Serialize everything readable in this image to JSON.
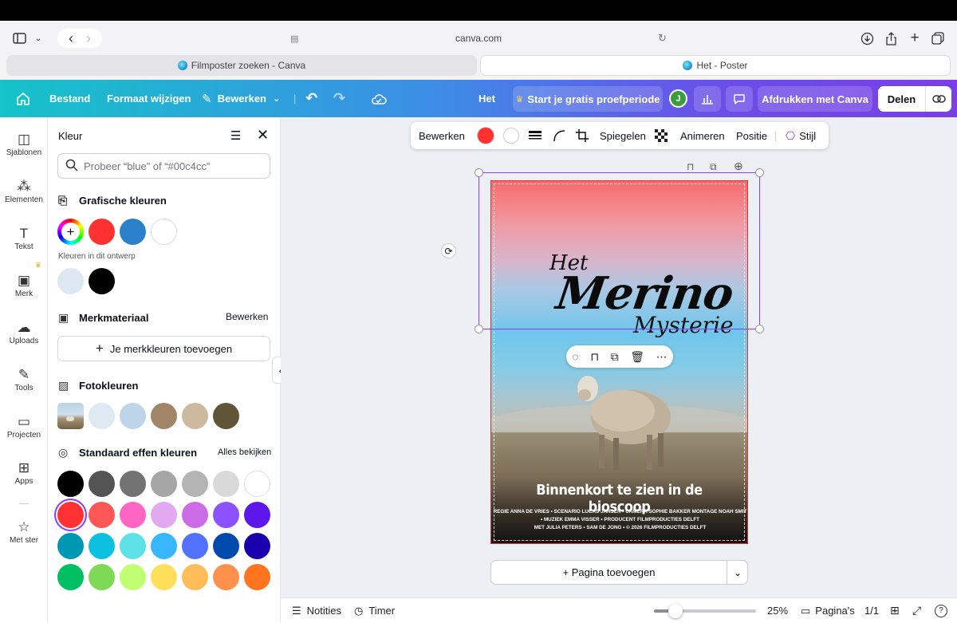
{
  "browser": {
    "url": "canva.com",
    "tabs": [
      {
        "label": "Filmposter zoeken - Canva",
        "active": false
      },
      {
        "label": "Het - Poster",
        "active": true
      }
    ]
  },
  "header": {
    "home_icon": "home-icon",
    "file": "Bestand",
    "resize": "Formaat wijzigen",
    "edit": "Bewerken",
    "doc_title": "Het",
    "trial": "Start je gratis proefperiode",
    "avatar": "J",
    "print": "Afdrukken met Canva",
    "share": "Delen"
  },
  "rail": [
    {
      "label": "Sjablonen",
      "icon": "templates-icon",
      "glyph": "◫"
    },
    {
      "label": "Elementen",
      "icon": "elements-icon",
      "glyph": "⁂"
    },
    {
      "label": "Tekst",
      "icon": "text-icon",
      "glyph": "T"
    },
    {
      "label": "Merk",
      "icon": "brand-icon",
      "glyph": "▣"
    },
    {
      "label": "Uploads",
      "icon": "upload-icon",
      "glyph": "☁"
    },
    {
      "label": "Tools",
      "icon": "tools-icon",
      "glyph": "✎"
    },
    {
      "label": "Projecten",
      "icon": "folder-icon",
      "glyph": "▭"
    },
    {
      "label": "Apps",
      "icon": "apps-icon",
      "glyph": "⊞"
    },
    {
      "label": "Met ster",
      "icon": "star-icon",
      "glyph": "☆"
    }
  ],
  "panel": {
    "title": "Kleur",
    "search_placeholder": "Probeer “blue” of “#00c4cc”",
    "graphic_colors": "Grafische kleuren",
    "graphic_swatches": [
      "#ff3131",
      "#2a80c9",
      "#ffffff"
    ],
    "in_design": "Kleuren in dit ontwerp",
    "design_swatches": [
      "#dde8f3",
      "#000000"
    ],
    "brand": "Merkmateriaal",
    "brand_edit": "Bewerken",
    "add_brand": "Je merkkleuren toevoegen",
    "photo_colors": "Fotokleuren",
    "photo_swatches": [
      "#dfe9f2",
      "#bed4e8",
      "#a08567",
      "#cdb9a0",
      "#615538"
    ],
    "standard": "Standaard effen kleuren",
    "see_all": "Alles bekijken",
    "standard_rows": [
      [
        "#000000",
        "#545454",
        "#737373",
        "#a6a6a6",
        "#b4b4b4",
        "#d9d9d9",
        "#ffffff"
      ],
      [
        "#ff3131",
        "#ff5757",
        "#ff66c4",
        "#e2a9f1",
        "#cb6ce6",
        "#8c52ff",
        "#5e17eb"
      ],
      [
        "#0097b2",
        "#0cc0df",
        "#5ce1e6",
        "#38b6ff",
        "#5271ff",
        "#004aad",
        "#1800ad"
      ],
      [
        "#00bf63",
        "#7ed957",
        "#c1ff72",
        "#ffde59",
        "#ffbd59",
        "#ff914d",
        "#ff751f"
      ]
    ]
  },
  "toolbar": {
    "edit": "Bewerken",
    "fill_color": "#ff3131",
    "flip": "Spiegelen",
    "animate": "Animeren",
    "position": "Positie",
    "style": "Stijl"
  },
  "poster": {
    "title_small": "Het",
    "title_big": "Merino",
    "title_sub": "Mysterie",
    "tagline": "Binnenkort te zien in de bioscoop",
    "credits": [
      "REGIE ANNA DE VRIES • SCENARIO LUCAS JANSEN • CAMERA SOPHIE BAKKER MONTAGE NOAH SMIT",
      "• MUZIEK EMMA VISSER • PRODUCENT FILMPRODUCTIES DELFT",
      "MET JULIA PETERS • SAM DE JONG • © 2026 FILMPRODUCTIES DELFT"
    ]
  },
  "add_page": "+ Pagina toevoegen",
  "footer": {
    "notes": "Notities",
    "timer": "Timer",
    "zoom": "25%",
    "zoom_fraction": 0.25,
    "pages": "Pagina's",
    "page_count": "1/1"
  }
}
